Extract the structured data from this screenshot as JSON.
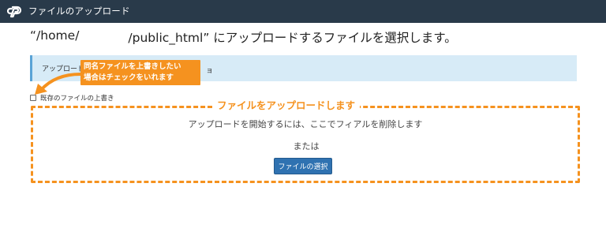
{
  "header": {
    "logo_icon": "cpanel-logo-icon",
    "title": "ファイルのアップロード"
  },
  "heading": {
    "prefix": "“/home/",
    "suffix": "/public_html” にアップロードするファイルを選択します。"
  },
  "info": {
    "text": "アップロード",
    "trail": "ョ"
  },
  "callout": {
    "line1": "同名ファイルを上書きしたい",
    "line2": "場合はチェックをいれます",
    "color": "#f5921f"
  },
  "overwrite": {
    "label": "既存のファイルの上書き",
    "checked": false
  },
  "dropzone": {
    "label": "ファイルをアップロードします",
    "instructions": "アップロードを開始するには、ここでフィアルを削除します",
    "or": "または",
    "button": "ファイルの選択"
  },
  "colors": {
    "topbar": "#293a4a",
    "accent": "#f5921f",
    "info_bg": "#d7ebf7",
    "button": "#2f72b1"
  }
}
